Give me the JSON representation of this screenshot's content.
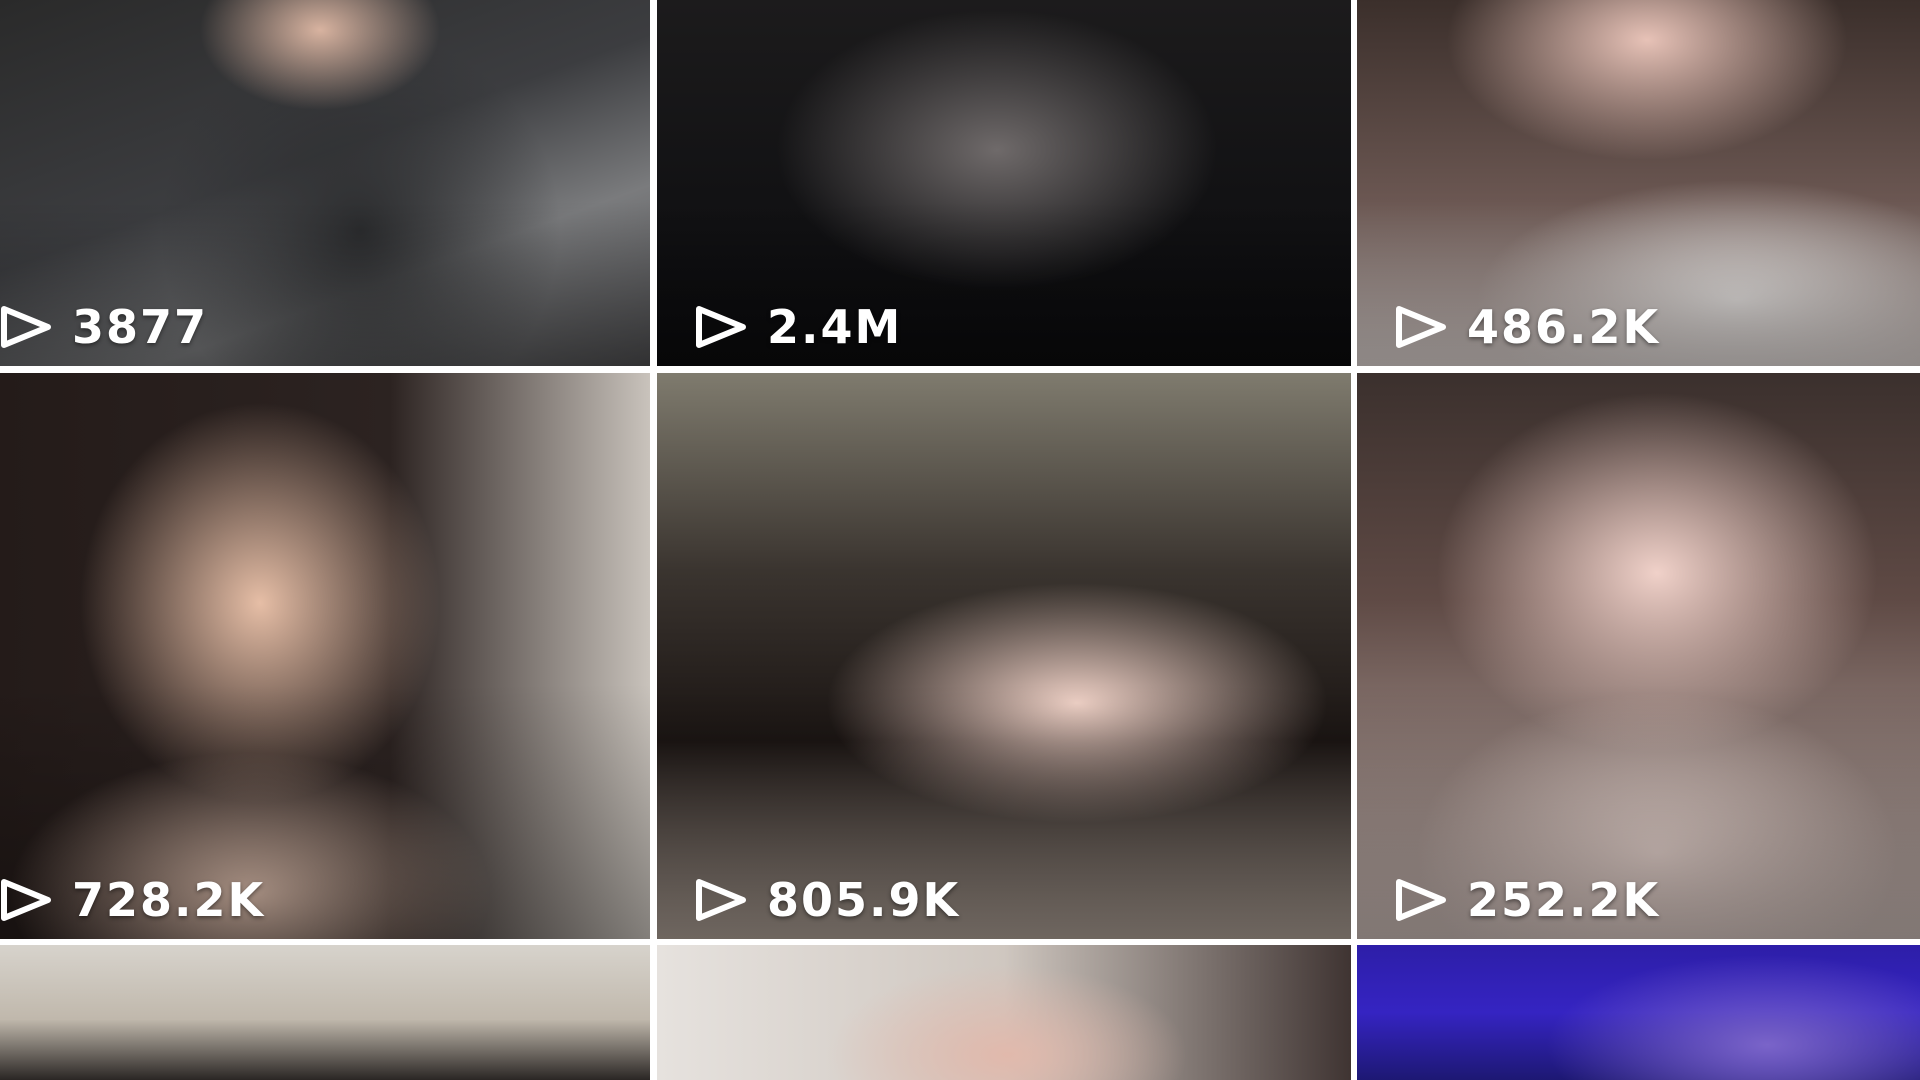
{
  "grid": {
    "videos": [
      {
        "views": "3877",
        "icon": "play-icon"
      },
      {
        "views": "2.4M",
        "icon": "play-icon"
      },
      {
        "views": "486.2K",
        "icon": "play-icon"
      },
      {
        "views": "728.2K",
        "icon": "play-icon"
      },
      {
        "views": "805.9K",
        "icon": "play-icon"
      },
      {
        "views": "252.2K",
        "icon": "play-icon"
      },
      {
        "views": "",
        "icon": ""
      },
      {
        "views": "",
        "icon": ""
      },
      {
        "views": "",
        "icon": ""
      }
    ]
  },
  "colors": {
    "background": "#ffffff",
    "overlay_text": "#ffffff"
  }
}
